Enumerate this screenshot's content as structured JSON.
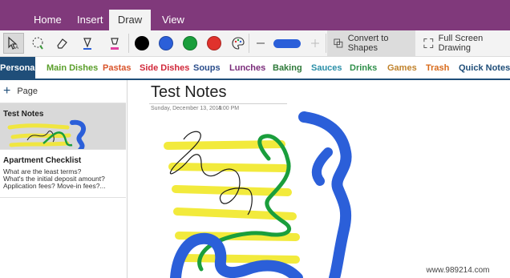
{
  "ribbon": {
    "tabs": [
      {
        "label": "Home"
      },
      {
        "label": "Insert"
      },
      {
        "label": "Draw"
      },
      {
        "label": "View"
      }
    ]
  },
  "toolbar": {
    "colors": [
      "#000000",
      "#2b5fd9",
      "#1a9e3c",
      "#e0322c"
    ],
    "convert_label": "Convert to Shapes",
    "fullscreen_label": "Full Screen Drawing"
  },
  "sections": [
    {
      "label": "Personal",
      "color": "#ffffff"
    },
    {
      "label": "Main Dishes",
      "color": "#5a9e2a"
    },
    {
      "label": "Pastas",
      "color": "#d9542b"
    },
    {
      "label": "Side Dishes",
      "color": "#d1283a"
    },
    {
      "label": "Soups",
      "color": "#2b4e8c"
    },
    {
      "label": "Lunches",
      "color": "#7a2b7a"
    },
    {
      "label": "Baking",
      "color": "#2f7a3a"
    },
    {
      "label": "Sauces",
      "color": "#2a8fa8"
    },
    {
      "label": "Drinks",
      "color": "#2f8f4a"
    },
    {
      "label": "Games",
      "color": "#c0822b"
    },
    {
      "label": "Trash",
      "color": "#d86a1a"
    },
    {
      "label": "Quick Notes",
      "color": "#1f4e79"
    }
  ],
  "pages_pane": {
    "add_label": "Page",
    "pages": [
      {
        "title": "Test Notes",
        "lines": []
      },
      {
        "title": "Apartment Checklist",
        "lines": [
          "What are the least terms?",
          "What's the initial deposit amount?",
          "Application fees? Move-in fees?..."
        ]
      }
    ]
  },
  "note": {
    "title": "Test Notes",
    "date": "Sunday, December 13, 2015",
    "time": "4:00 PM"
  },
  "watermark": "www.989214.com"
}
